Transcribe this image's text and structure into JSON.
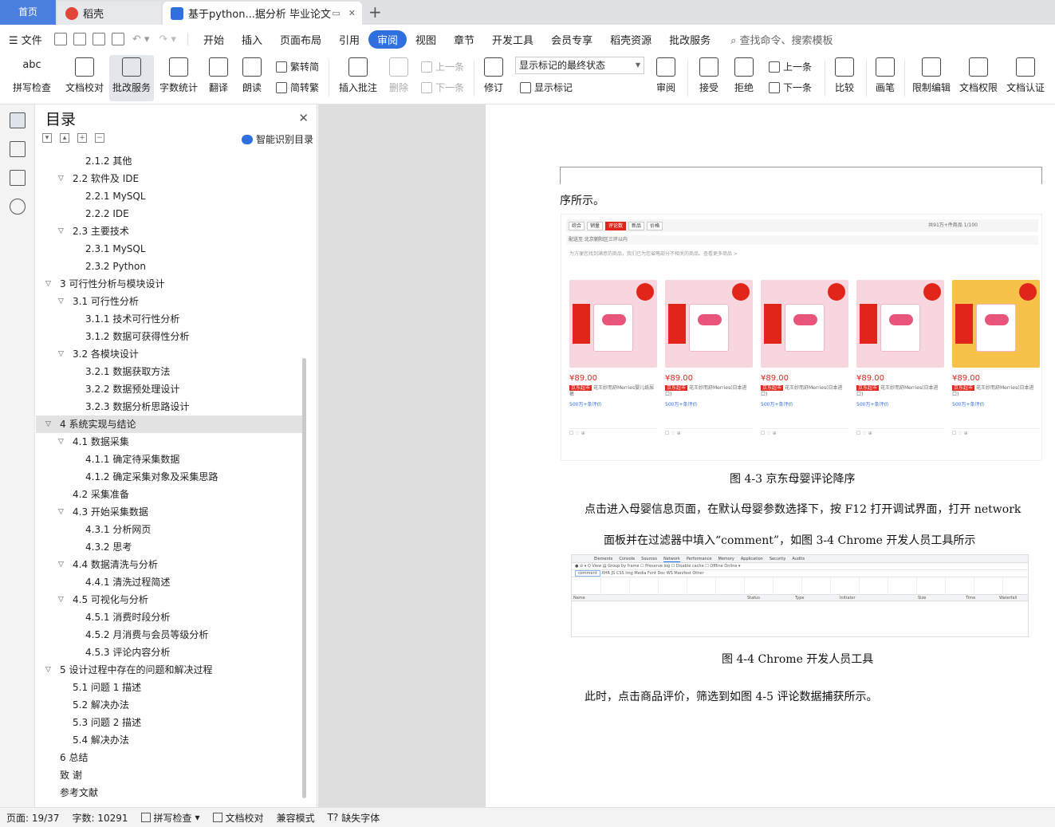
{
  "tabs": {
    "home": "首页",
    "docer": "稻壳",
    "document": "基于python...据分析 毕业论文"
  },
  "menu": {
    "file": "文件",
    "items": [
      "开始",
      "插入",
      "页面布局",
      "引用",
      "审阅",
      "视图",
      "章节",
      "开发工具",
      "会员专享",
      "稻壳资源",
      "批改服务"
    ],
    "active": "审阅",
    "search": "查找命令、搜索模板"
  },
  "ribbon": {
    "spell": "拼写检查",
    "proof": "文档校对",
    "correct": "批改服务",
    "count": "字数统计",
    "translate": "翻译",
    "read": "朗读",
    "trad": "繁转简",
    "simp": "简转繁",
    "insert_comment": "插入批注",
    "delete": "删除",
    "prev_c": "上一条",
    "next_c": "下一条",
    "revise": "修订",
    "combo": "显示标记的最终状态",
    "show_marks": "显示标记",
    "review": "审阅",
    "accept": "接受",
    "reject": "拒绝",
    "prev": "上一条",
    "next": "下一条",
    "compare": "比较",
    "pen": "画笔",
    "restrict": "限制编辑",
    "perm": "文档权限",
    "cert": "文档认证"
  },
  "toc": {
    "title": "目录",
    "smart": "智能识别目录",
    "items": [
      {
        "text": "2.1.2  其他",
        "level": 3
      },
      {
        "text": "2.2 软件及 IDE",
        "level": 2,
        "arrow": true
      },
      {
        "text": "2.2.1 MySQL",
        "level": 3
      },
      {
        "text": "2.2.2 IDE",
        "level": 3
      },
      {
        "text": "2.3 主要技术",
        "level": 2,
        "arrow": true
      },
      {
        "text": "2.3.1 MySQL",
        "level": 3
      },
      {
        "text": "2.3.2 Python",
        "level": 3
      },
      {
        "text": "3  可行性分析与模块设计",
        "level": 1,
        "arrow": true
      },
      {
        "text": "3.1  可行性分析",
        "level": 2,
        "arrow": true
      },
      {
        "text": "3.1.1  技术可行性分析",
        "level": 3
      },
      {
        "text": "3.1.2  数据可获得性分析",
        "level": 3
      },
      {
        "text": "3.2  各模块设计",
        "level": 2,
        "arrow": true
      },
      {
        "text": "3.2.1  数据获取方法",
        "level": 3
      },
      {
        "text": "3.2.2  数据预处理设计",
        "level": 3
      },
      {
        "text": "3.2.3  数据分析思路设计",
        "level": 3
      },
      {
        "text": "4  系统实现与结论",
        "level": 1,
        "arrow": true,
        "selected": true
      },
      {
        "text": "4.1 数据采集",
        "level": 2,
        "arrow": true
      },
      {
        "text": "4.1.1 确定待采集数据",
        "level": 3
      },
      {
        "text": "4.1.2 确定采集对象及采集思路",
        "level": 3
      },
      {
        "text": "4.2 采集准备",
        "level": 2
      },
      {
        "text": "4.3 开始采集数据",
        "level": 2,
        "arrow": true
      },
      {
        "text": "4.3.1 分析网页",
        "level": 3
      },
      {
        "text": "4.3.2 思考",
        "level": 3
      },
      {
        "text": "4.4 数据清洗与分析",
        "level": 2,
        "arrow": true
      },
      {
        "text": "4.4.1 清洗过程简述",
        "level": 3
      },
      {
        "text": "4.5  可视化与分析",
        "level": 2,
        "arrow": true
      },
      {
        "text": "4.5.1 消费时段分析",
        "level": 3
      },
      {
        "text": "4.5.2 月消费与会员等级分析",
        "level": 3
      },
      {
        "text": "4.5.3 评论内容分析",
        "level": 3
      },
      {
        "text": "5  设计过程中存在的问题和解决过程",
        "level": 1,
        "arrow": true
      },
      {
        "text": "5.1 问题 1 描述",
        "level": 2
      },
      {
        "text": "5.2 解决办法",
        "level": 2
      },
      {
        "text": "5.3 问题 2 描述",
        "level": 2
      },
      {
        "text": "5.4 解决办法",
        "level": 2
      },
      {
        "text": "6  总结",
        "level": 1
      },
      {
        "text": "致    谢",
        "level": 1
      },
      {
        "text": "参考文献",
        "level": 1
      }
    ]
  },
  "doc": {
    "line1": "序所示。",
    "caption1": "图 4-3  京东母婴评论降序",
    "para1": "点击进入母婴信息页面，在默认母婴参数选择下，按 F12 打开调试界面，打开 network",
    "para2": "面板并在过滤器中填入“comment”，如图 3-4 Chrome 开发人员工具所示",
    "caption2": "图 4-4 Chrome 开发人员工具",
    "para3": "此时，点击商品评价，筛选到如图 4-5 评论数据捕获所示。"
  },
  "jd": {
    "filters": [
      "综合",
      "销量",
      "评论数",
      "新品",
      "价格"
    ],
    "active_filter": "评论数",
    "page_info": "共91万+件商品  1/100",
    "ship_to": "配送至  北京朝阳区三环以内",
    "tip": "为方便您找到满意的商品，我们已为您省略部分不相关的商品。查看更多商品 >",
    "products": [
      {
        "price": "¥89.00",
        "desc": "花王妙而舒Merries婴儿纸尿裤",
        "comments": "500万+条评价",
        "yellow": false
      },
      {
        "price": "¥89.00",
        "desc": "花王妙而舒Merries(日本进口)",
        "comments": "500万+条评价",
        "yellow": false
      },
      {
        "price": "¥89.00",
        "desc": "花王妙而舒Merries(日本进口)",
        "comments": "500万+条评价",
        "yellow": false
      },
      {
        "price": "¥89.00",
        "desc": "花王妙而舒Merries(日本进口)",
        "comments": "500万+条评价",
        "yellow": false
      },
      {
        "price": "¥89.00",
        "desc": "花王妙而舒Merries(日本进口)",
        "comments": "500万+条评价",
        "yellow": true
      }
    ],
    "jd_tag": "京东超市"
  },
  "devtools": {
    "tabs": [
      "Elements",
      "Console",
      "Sources",
      "Network",
      "Performance",
      "Memory",
      "Application",
      "Security",
      "Audits"
    ],
    "filter": "comment",
    "columns": [
      "Name",
      "Status",
      "Type",
      "Initiator",
      "Size",
      "Time",
      "Waterfall"
    ]
  },
  "status": {
    "page": "页面: 19/37",
    "words": "字数: 10291",
    "spell": "拼写检查",
    "proof": "文档校对",
    "compat": "兼容模式",
    "font": "缺失字体"
  }
}
